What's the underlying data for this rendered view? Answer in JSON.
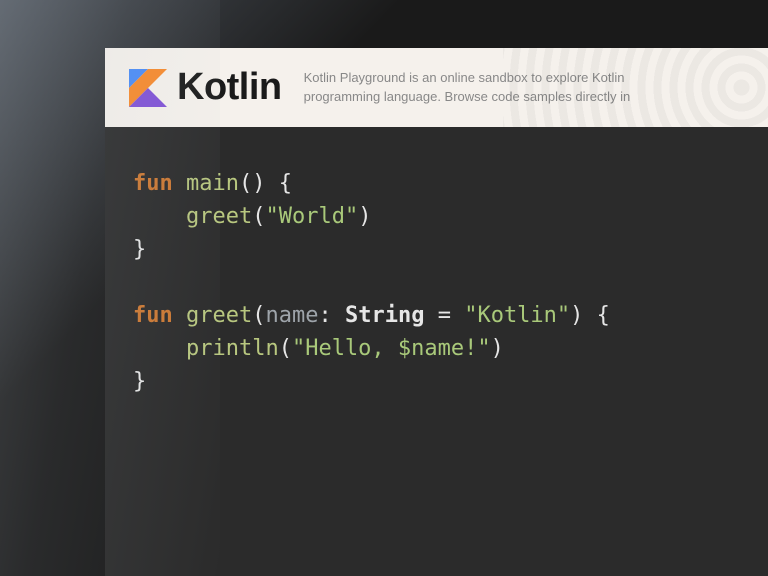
{
  "brand": {
    "name": "Kotlin",
    "logo_name": "kotlin-logo"
  },
  "tagline": {
    "line1": "Kotlin Playground is an online sandbox to explore Kotlin",
    "line2": "programming language. Browse code samples directly in"
  },
  "code": {
    "l1_kw": "fun",
    "l1_fn": "main",
    "l1_rest": "() {",
    "l2_call": "greet",
    "l2_str": "\"World\"",
    "l2_close": ")",
    "l3": "}",
    "l5_kw": "fun",
    "l5_fn": "greet",
    "l5_open": "(",
    "l5_param": "name",
    "l5_colon": ": ",
    "l5_type": "String",
    "l5_eq": " = ",
    "l5_str": "\"Kotlin\"",
    "l5_close": ") {",
    "l6_call": "println",
    "l6_open": "(",
    "l6_str": "\"Hello, $name!\"",
    "l6_close": ")",
    "l7": "}"
  }
}
